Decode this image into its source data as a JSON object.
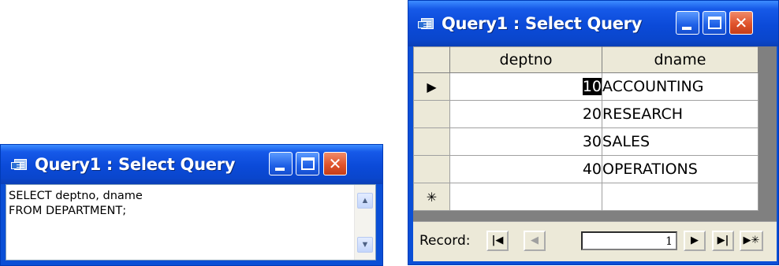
{
  "sql_window": {
    "title": "Query1 : Select Query",
    "sql_lines": [
      "SELECT deptno, dname",
      "FROM DEPARTMENT;"
    ],
    "scroll_up_glyph": "▲",
    "scroll_down_glyph": "▼",
    "minimize_icon": "minimize-icon",
    "maximize_icon": "maximize-icon",
    "close_icon": "close-icon",
    "close_glyph": "✕"
  },
  "data_window": {
    "title": "Query1 : Select Query",
    "columns": [
      "deptno",
      "dname"
    ],
    "rows": [
      {
        "selector": "▶",
        "deptno": "10",
        "dname": "ACCOUNTING"
      },
      {
        "selector": "",
        "deptno": "20",
        "dname": "RESEARCH"
      },
      {
        "selector": "",
        "deptno": "30",
        "dname": "SALES"
      },
      {
        "selector": "",
        "deptno": "40",
        "dname": "OPERATIONS"
      }
    ],
    "new_row_selector": "✳",
    "record_label": "Record:",
    "record_value": "1",
    "nav": {
      "first": "|◀",
      "prev": "◀",
      "next": "▶",
      "last": "▶|",
      "new": "▶✳"
    },
    "close_glyph": "✕",
    "colors": {
      "title_bar": "#0b4ad8",
      "close_button": "#e0532c",
      "header_bg": "#ece9d8",
      "grid_bg": "#808080"
    }
  }
}
